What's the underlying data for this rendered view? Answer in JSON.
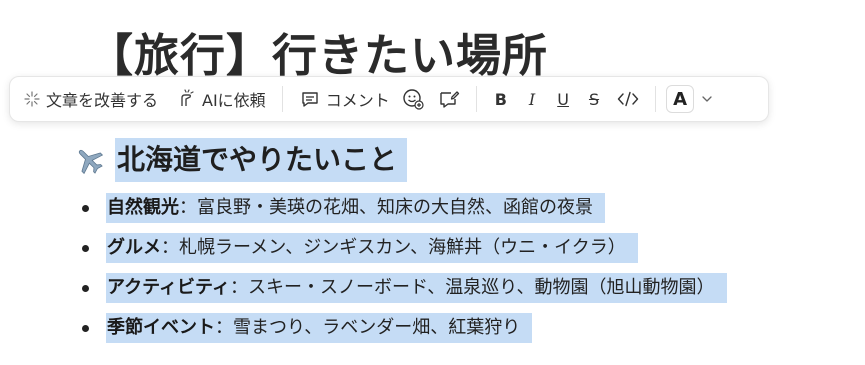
{
  "page": {
    "title": "【旅行】行きたい場所"
  },
  "toolbar": {
    "improve_label": "文章を改善する",
    "ai_label": "AIに依頼",
    "comment_label": "コメント",
    "bold_glyph": "B",
    "italic_glyph": "I",
    "underline_glyph": "U",
    "strike_glyph": "S",
    "code_glyph": "</>",
    "text_color_glyph": "A",
    "icons": [
      "sparkle-icon",
      "ai-hand-icon",
      "comment-icon",
      "emoji-add-icon",
      "edit-comment-icon",
      "code-icon",
      "chevron-down-icon"
    ]
  },
  "content": {
    "heading_icon": "airplane-icon",
    "heading": "北海道でやりたいこと",
    "items": [
      {
        "title": "自然観光",
        "separator": "：",
        "text": "富良野・美瑛の花畑、知床の大自然、函館の夜景"
      },
      {
        "title": "グルメ",
        "separator": "：",
        "text": "札幌ラーメン、ジンギスカン、海鮮丼（ウニ・イクラ）"
      },
      {
        "title": "アクティビティ",
        "separator": "：",
        "text": "スキー・スノーボード、温泉巡り、動物園（旭山動物園）"
      },
      {
        "title": "季節イベント",
        "separator": "：",
        "text": "雪まつり、ラベンダー畑、紅葉狩り"
      }
    ]
  },
  "colors": {
    "selection": "#c5dcf5",
    "text": "#1f1f1f",
    "toolbar_border": "#e6e6e6"
  }
}
